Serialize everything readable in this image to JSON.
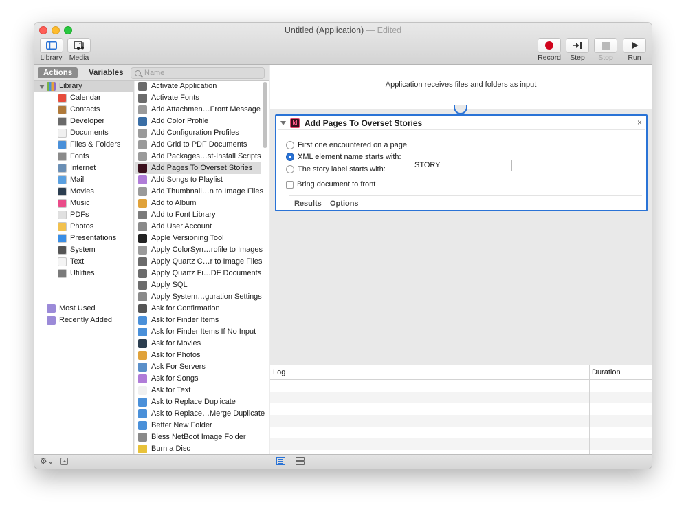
{
  "window": {
    "title": "Untitled (Application)",
    "edited": "— Edited"
  },
  "toolbar": {
    "library_label": "Library",
    "media_label": "Media",
    "record_label": "Record",
    "step_label": "Step",
    "stop_label": "Stop",
    "run_label": "Run"
  },
  "tabs": {
    "actions": "Actions",
    "variables": "Variables"
  },
  "search": {
    "placeholder": "Name"
  },
  "library": {
    "root": "Library",
    "items": [
      "Calendar",
      "Contacts",
      "Developer",
      "Documents",
      "Files & Folders",
      "Fonts",
      "Internet",
      "Mail",
      "Movies",
      "Music",
      "PDFs",
      "Photos",
      "Presentations",
      "System",
      "Text",
      "Utilities"
    ],
    "extras": [
      "Most Used",
      "Recently Added"
    ]
  },
  "actions": [
    "Activate Application",
    "Activate Fonts",
    "Add Attachmen…Front Message",
    "Add Color Profile",
    "Add Configuration Profiles",
    "Add Grid to PDF Documents",
    "Add Packages…st-Install Scripts",
    "Add Pages To Overset Stories",
    "Add Songs to Playlist",
    "Add Thumbnail…n to Image Files",
    "Add to Album",
    "Add to Font Library",
    "Add User Account",
    "Apple Versioning Tool",
    "Apply ColorSyn…rofile to Images",
    "Apply Quartz C…r to Image Files",
    "Apply Quartz Fi…DF Documents",
    "Apply SQL",
    "Apply System…guration Settings",
    "Ask for Confirmation",
    "Ask for Finder Items",
    "Ask for Finder Items If No Input",
    "Ask for Movies",
    "Ask for Photos",
    "Ask For Servers",
    "Ask for Songs",
    "Ask for Text",
    "Ask to Replace Duplicate",
    "Ask to Replace…Merge Duplicate",
    "Better New Folder",
    "Bless NetBoot Image Folder",
    "Burn a Disc"
  ],
  "workflow": {
    "input_text": "Application receives files and folders as input",
    "action": {
      "icon_text": "Id",
      "title": "Add Pages To Overset Stories",
      "close": "×",
      "option_first": "First one encountered on a page",
      "option_xml": "XML element name starts with:",
      "option_story": "The story label starts with:",
      "story_value": "STORY",
      "bring_front": "Bring document to front",
      "tab_results": "Results",
      "tab_options": "Options"
    }
  },
  "log": {
    "col_log": "Log",
    "col_duration": "Duration"
  },
  "bottombar": {
    "gear": "⚙︎⌄"
  }
}
